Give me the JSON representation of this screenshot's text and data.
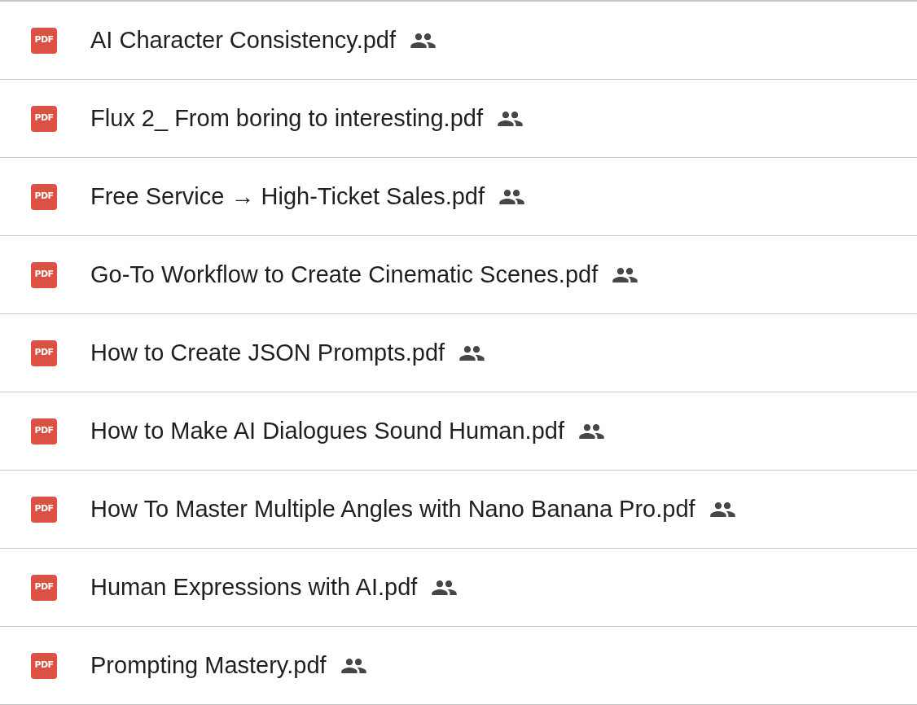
{
  "files": [
    {
      "name": "AI Character Consistency.pdf",
      "file_type": "PDF",
      "shared": true
    },
    {
      "name": "Flux 2_ From boring to interesting.pdf",
      "file_type": "PDF",
      "shared": true
    },
    {
      "name": "Free Service → High-Ticket Sales.pdf",
      "file_type": "PDF",
      "shared": true
    },
    {
      "name": "Go-To Workflow to Create Cinematic Scenes.pdf",
      "file_type": "PDF",
      "shared": true
    },
    {
      "name": "How to Create JSON Prompts.pdf",
      "file_type": "PDF",
      "shared": true
    },
    {
      "name": "How to Make AI Dialogues Sound Human.pdf",
      "file_type": "PDF",
      "shared": true
    },
    {
      "name": "How To Master Multiple Angles with Nano Banana Pro.pdf",
      "file_type": "PDF",
      "shared": true
    },
    {
      "name": "Human Expressions with AI.pdf",
      "file_type": "PDF",
      "shared": true
    },
    {
      "name": "Prompting Mastery.pdf",
      "file_type": "PDF",
      "shared": true
    }
  ]
}
